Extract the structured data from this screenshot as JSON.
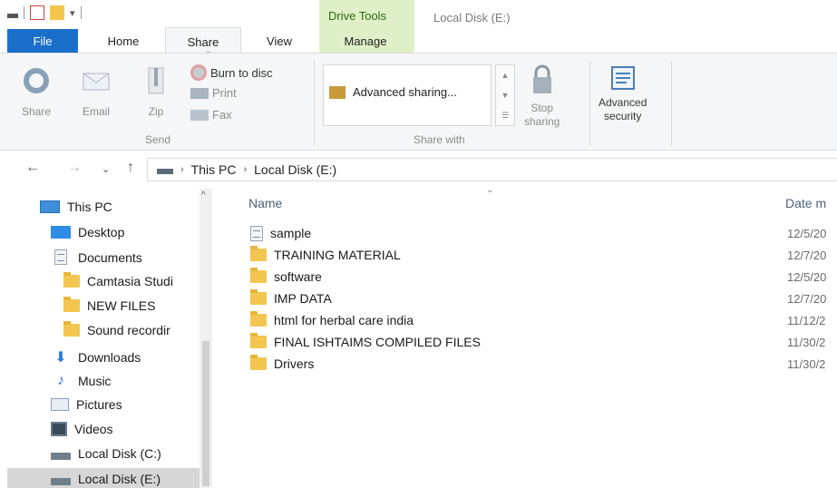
{
  "window": {
    "context_tab_label": "Drive Tools",
    "title": "Local Disk (E:)"
  },
  "tabs": {
    "file": "File",
    "home": "Home",
    "share": "Share",
    "view": "View",
    "manage": "Manage"
  },
  "ribbon": {
    "send_group": {
      "label": "Send",
      "share": "Share",
      "email": "Email",
      "zip": "Zip",
      "burn": "Burn to disc",
      "print": "Print",
      "fax": "Fax"
    },
    "share_with_group": {
      "label": "Share with",
      "advanced_sharing": "Advanced sharing...",
      "stop_sharing_line1": "Stop",
      "stop_sharing_line2": "sharing"
    },
    "security": {
      "line1": "Advanced",
      "line2": "security"
    }
  },
  "address": {
    "crumbs": [
      "This PC",
      "Local Disk (E:)"
    ]
  },
  "nav": {
    "items": [
      {
        "label": "This PC"
      },
      {
        "label": "Desktop"
      },
      {
        "label": "Documents"
      },
      {
        "label": "Camtasia Studi"
      },
      {
        "label": "NEW FILES"
      },
      {
        "label": "Sound recordir"
      },
      {
        "label": "Downloads"
      },
      {
        "label": "Music"
      },
      {
        "label": "Pictures"
      },
      {
        "label": "Videos"
      },
      {
        "label": "Local Disk (C:)"
      },
      {
        "label": "Local Disk (E:)"
      }
    ]
  },
  "files": {
    "columns": {
      "name": "Name",
      "date": "Date m"
    },
    "rows": [
      {
        "name": "sample",
        "date": "12/5/20",
        "icon": "document-icon"
      },
      {
        "name": "TRAINING MATERIAL",
        "date": "12/7/20",
        "icon": "folder-icon"
      },
      {
        "name": "software",
        "date": "12/5/20",
        "icon": "folder-icon"
      },
      {
        "name": "IMP DATA",
        "date": "12/7/20",
        "icon": "folder-icon"
      },
      {
        "name": "html for herbal care india",
        "date": "11/12/2",
        "icon": "folder-icon"
      },
      {
        "name": "FINAL ISHTAIMS COMPILED FILES",
        "date": "11/30/2",
        "icon": "folder-icon"
      },
      {
        "name": "Drivers",
        "date": "11/30/2",
        "icon": "folder-icon"
      }
    ]
  },
  "colors": {
    "file_tab": "#1a6fcb",
    "context_tab": "#dff0c8",
    "ribbon_bg": "#f5f6f7",
    "folder": "#f3c64f"
  }
}
